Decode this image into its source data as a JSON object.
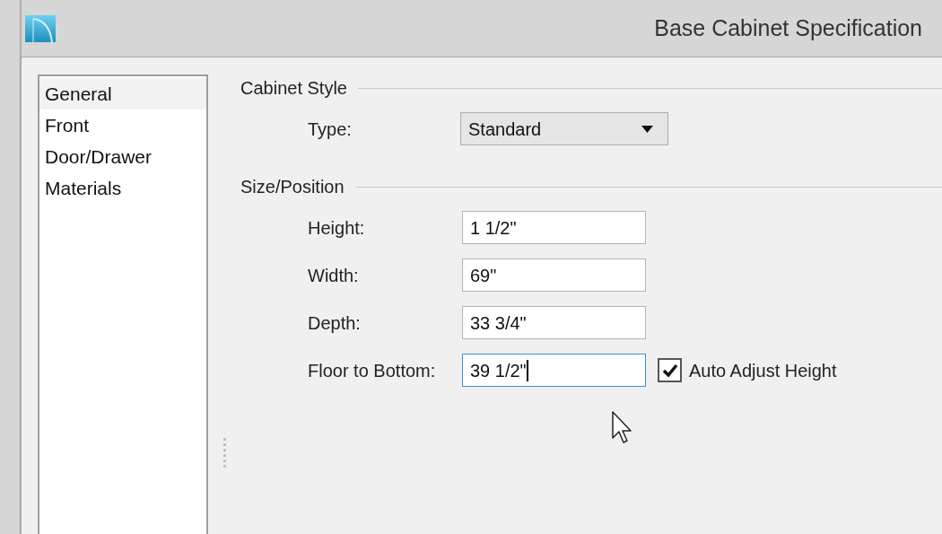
{
  "window": {
    "title": "Base Cabinet Specification"
  },
  "sidebar": {
    "items": [
      {
        "label": "General",
        "selected": true
      },
      {
        "label": "Front",
        "selected": false
      },
      {
        "label": "Door/Drawer",
        "selected": false
      },
      {
        "label": "Materials",
        "selected": false
      }
    ]
  },
  "sections": [
    {
      "title": "Cabinet Style",
      "fields": [
        {
          "kind": "dropdown",
          "label": "Type:",
          "value": "Standard"
        }
      ]
    },
    {
      "title": "Size/Position",
      "fields": [
        {
          "kind": "text",
          "label": "Height:",
          "value": "1 1/2\"",
          "focused": false
        },
        {
          "kind": "text",
          "label": "Width:",
          "value": "69\"",
          "focused": false
        },
        {
          "kind": "text",
          "label": "Depth:",
          "value": "33 3/4\"",
          "focused": false
        },
        {
          "kind": "text",
          "label": "Floor to Bottom:",
          "value": "39 1/2\"",
          "focused": true,
          "checkbox": {
            "label": "Auto Adjust Height",
            "checked": true
          }
        }
      ]
    }
  ]
}
